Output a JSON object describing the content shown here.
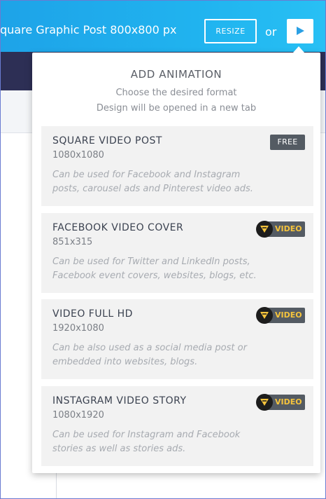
{
  "topbar": {
    "title": "quare Graphic Post 800x800 px",
    "resize_label": "RESIZE",
    "or_label": "or",
    "play_icon": "play-icon"
  },
  "dropdown": {
    "title": "ADD ANIMATION",
    "subtitle_line1": "Choose the desired format",
    "subtitle_line2": "Design will be opened in a new tab",
    "options": [
      {
        "title": "SQUARE VIDEO POST",
        "size": "1080x1080",
        "desc_line1": "Can be used for Facebook and Instagram",
        "desc_line2": "posts, carousel ads and Pinterest video ads.",
        "badge": "FREE"
      },
      {
        "title": "FACEBOOK VIDEO COVER",
        "size": "851x315",
        "desc_line1": "Can be used for Twitter and LinkedIn posts,",
        "desc_line2": "Facebook event covers, websites, blogs, etc.",
        "badge": "VIDEO"
      },
      {
        "title": "VIDEO FULL HD",
        "size": "1920x1080",
        "desc_line1": "Can be also used as a social media post or",
        "desc_line2": "embedded into websites, blogs.",
        "badge": "VIDEO"
      },
      {
        "title": "INSTAGRAM VIDEO STORY",
        "size": "1080x1920",
        "desc_line1": "Can be used for Instagram and Facebook",
        "desc_line2": "stories as well as stories ads.",
        "badge": "VIDEO"
      }
    ]
  },
  "colors": {
    "topbar": "#1ea3e8",
    "badge_bg": "#545b63",
    "video_badge_text": "#f6c43c",
    "card_bg": "#f2f2f2"
  }
}
